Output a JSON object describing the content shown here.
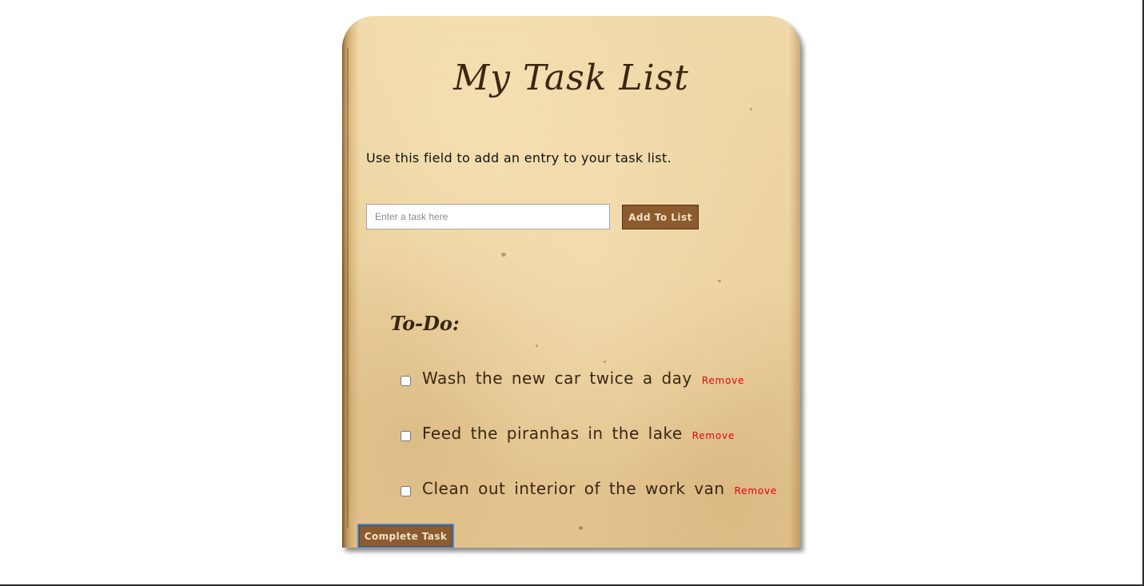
{
  "app": {
    "title": "My Task List",
    "instructions": "Use this field to add an entry to your task list."
  },
  "form": {
    "input_value": "",
    "input_placeholder": "Enter a task here",
    "add_button_label": "Add To List"
  },
  "todo": {
    "heading": "To-Do:",
    "items": [
      {
        "label": "Wash the new car twice a day",
        "checked": false,
        "remove_label": "Remove"
      },
      {
        "label": "Feed the piranhas in the lake",
        "checked": false,
        "remove_label": "Remove"
      },
      {
        "label": "Clean out interior of the work van",
        "checked": false,
        "remove_label": "Remove"
      }
    ]
  },
  "actions": {
    "complete_button_label": "Complete Task"
  },
  "colors": {
    "paper": "#e7cc97",
    "button_bg": "#8c5b2f",
    "title_text": "#3a2712",
    "remove_link": "#e8000c",
    "focus_ring": "#5c86b8"
  }
}
